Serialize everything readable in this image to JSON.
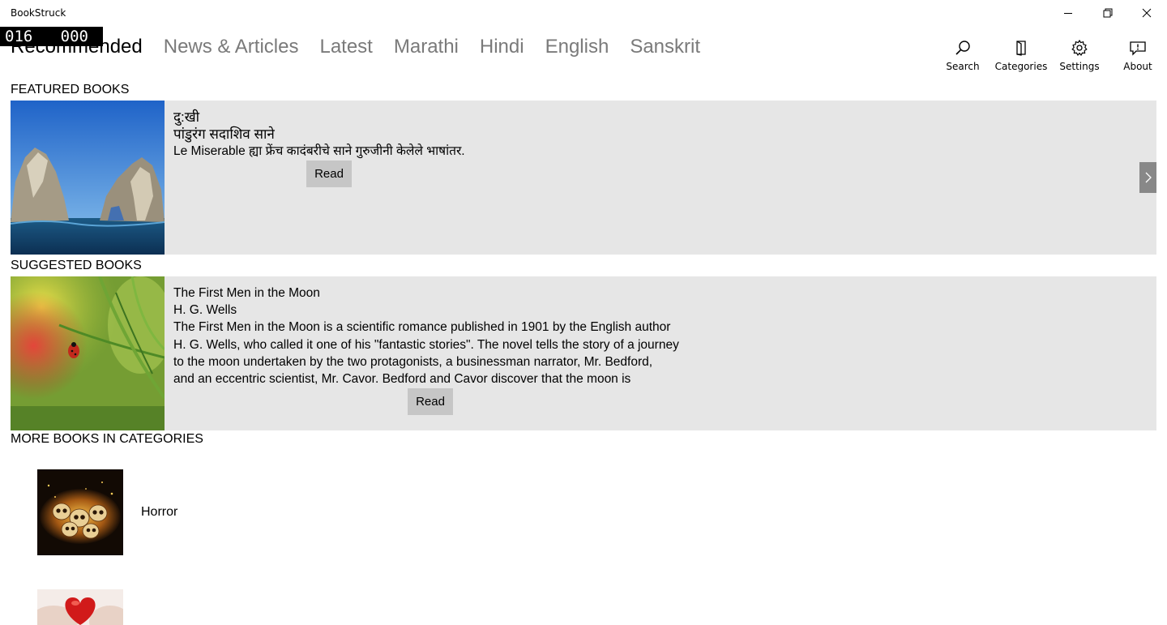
{
  "window": {
    "title": "BookStruck",
    "controls": [
      "minimize-icon",
      "restore-icon",
      "close-icon"
    ]
  },
  "frame_counter": {
    "left": "016",
    "right": "000"
  },
  "pivot": {
    "items": [
      {
        "label": "Recommended",
        "active": true
      },
      {
        "label": "News & Articles",
        "active": false
      },
      {
        "label": "Latest",
        "active": false
      },
      {
        "label": "Marathi",
        "active": false
      },
      {
        "label": "Hindi",
        "active": false
      },
      {
        "label": "English",
        "active": false
      },
      {
        "label": "Sanskrit",
        "active": false
      }
    ]
  },
  "commands": [
    {
      "label": "Search",
      "icon": "search-icon"
    },
    {
      "label": "Categories",
      "icon": "book-icon"
    },
    {
      "label": "Settings",
      "icon": "gear-icon"
    },
    {
      "label": "About",
      "icon": "message-icon"
    }
  ],
  "featured": {
    "heading": "FEATURED BOOKS",
    "title": "दु:खी",
    "author": "पांडुरंग सदाशिव साने",
    "description": "Le Miserable ह्या फ्रेंच कादंबरीचे साने गुरुजीनी केलेले भाषांतर.",
    "read_label": "Read",
    "image": "sea-arch-rock-image"
  },
  "suggested": {
    "heading": "SUGGESTED BOOKS",
    "title": "The First Men in the Moon",
    "author": "H. G. Wells",
    "description_lines": [
      "The First Men in the Moon is a scientific romance published in 1901 by the English author",
      "H. G. Wells, who called it one of his \"fantastic stories\". The novel tells the story of a journey",
      "to the moon undertaken by the two protagonists, a businessman narrator, Mr. Bedford,",
      "and an eccentric scientist, Mr. Cavor. Bedford and Cavor discover that the moon is"
    ],
    "read_label": "Read",
    "image": "ladybug-on-grass-image"
  },
  "more": {
    "heading": "MORE BOOKS IN CATEGORIES",
    "categories": [
      {
        "label": "Horror",
        "image": "skulls-fire-image"
      },
      {
        "label": "",
        "image": "red-heart-image"
      }
    ]
  },
  "colors": {
    "card_bg": "#e6e6e6",
    "button_bg": "#c6c6c6",
    "pivot_inactive": "#7a7a7a"
  }
}
